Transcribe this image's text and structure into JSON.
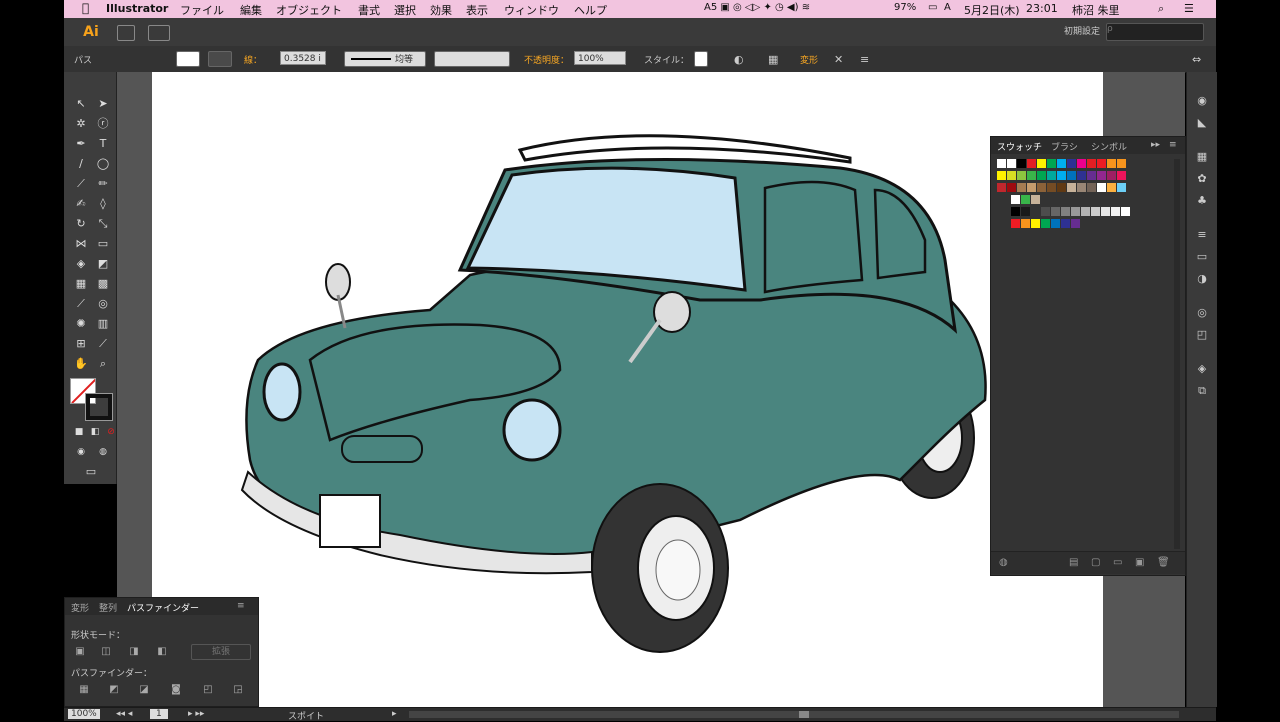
{
  "menubar": {
    "app_name": "Illustrator",
    "items": [
      "ファイル",
      "編集",
      "オブジェクト",
      "書式",
      "選択",
      "効果",
      "表示",
      "ウィンドウ",
      "ヘルプ"
    ],
    "battery": "97%",
    "date": "5月2日(木)",
    "time": "23:01",
    "user": "柿沼 朱里"
  },
  "appbar": {
    "logo": "Ai",
    "workspace": "初期設定",
    "search_placeholder": "ρ"
  },
  "control": {
    "object_type": "パス",
    "stroke_label": "線：",
    "stroke_weight": "0.3528 i",
    "profile_label": "均等",
    "opacity_label": "不透明度：",
    "opacity_value": "100%",
    "style_label": "スタイル：",
    "transform_label": "変形"
  },
  "swatches_panel": {
    "tabs": [
      "スウォッチ",
      "ブラシ",
      "シンボル"
    ],
    "rows": [
      [
        "#ffffff",
        "#ffffff",
        "#000000",
        "#e31e24",
        "#fff200",
        "#00a651",
        "#00aeef",
        "#2e3192",
        "#ec008c",
        "#e31e24",
        "#ed1c24",
        "#f7941d",
        "#f7941d"
      ],
      [
        "#fff200",
        "#d7df23",
        "#8dc63f",
        "#39b54a",
        "#00a651",
        "#00a99d",
        "#00aeef",
        "#0072bc",
        "#2e3192",
        "#662d91",
        "#92278f",
        "#9e1f63",
        "#ed145b"
      ],
      [
        "#c1272d",
        "#9e0b0f",
        "#a67c52",
        "#c69c6d",
        "#8c6239",
        "#754c24",
        "#603913",
        "#c7b299",
        "#998675",
        "#736357",
        "#ffffff",
        "#fbb040",
        "#6dcff6"
      ],
      [
        "#ffffff",
        "#39b54a",
        "#c7b299"
      ],
      [
        "#000000",
        "#1a1a1a",
        "#333333",
        "#4d4d4d",
        "#666666",
        "#808080",
        "#999999",
        "#b3b3b3",
        "#cccccc",
        "#e6e6e6",
        "#f2f2f2",
        "#ffffff"
      ],
      [
        "#ed1c24",
        "#f7941d",
        "#fff200",
        "#00a651",
        "#0072bc",
        "#2e3192",
        "#662d91"
      ]
    ]
  },
  "pathfinder_panel": {
    "tabs": [
      "変形",
      "整列",
      "パスファインダー"
    ],
    "shape_modes_label": "形状モード：",
    "expand_label": "拡張",
    "pathfinder_label": "パスファインダー："
  },
  "status": {
    "zoom": "100%",
    "page": "1",
    "tool_name": "スポイト"
  },
  "artwork": {
    "car_body_color": "#4a857f",
    "window_color": "#c8e4f4"
  }
}
